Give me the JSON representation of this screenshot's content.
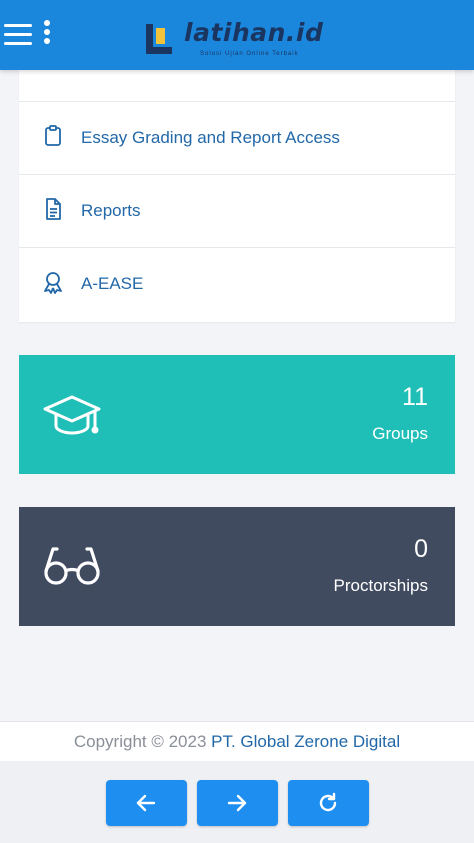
{
  "header": {
    "brand_name": "latihan.id",
    "brand_tagline": "Solusi Ujian Online Terbaik",
    "menu_icon": "hamburger-icon",
    "more_icon": "kebab-vertical-icon"
  },
  "menu": {
    "items": [
      {
        "label": "Essay Grading and Report Access",
        "icon": "clipboard-icon"
      },
      {
        "label": "Reports",
        "icon": "document-icon"
      },
      {
        "label": "A-EASE",
        "icon": "award-ribbon-icon"
      }
    ]
  },
  "stats": [
    {
      "value": "11",
      "label": "Groups",
      "icon": "graduation-cap-icon",
      "color": "#1fbfb8"
    },
    {
      "value": "0",
      "label": "Proctorships",
      "icon": "glasses-icon",
      "color": "#404b60"
    }
  ],
  "footer": {
    "copyright": "Copyright © 2023 ",
    "company": "PT. Global Zerone Digital"
  },
  "bottom_nav": {
    "back_icon": "arrow-left-icon",
    "forward_icon": "arrow-right-icon",
    "refresh_icon": "refresh-icon"
  },
  "colors": {
    "header": "#1a87dd",
    "link": "#2268a8",
    "button": "#1e8ff0"
  }
}
